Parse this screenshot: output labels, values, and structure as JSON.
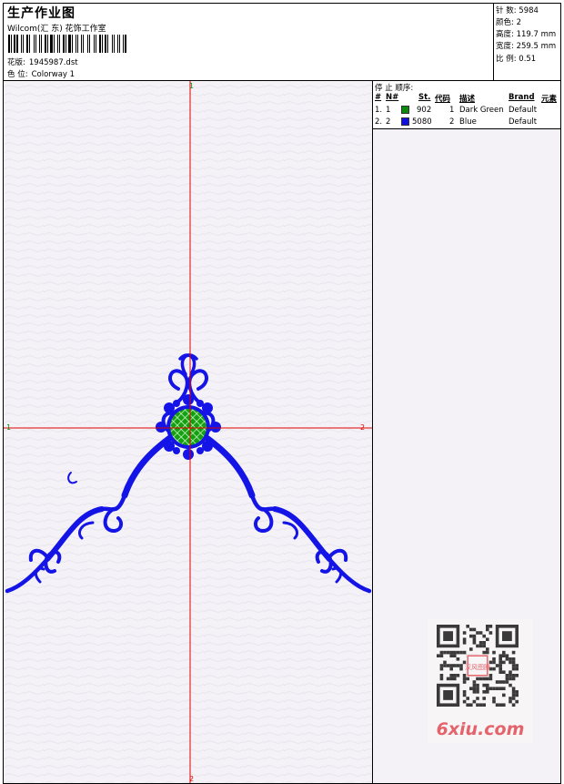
{
  "header": {
    "title": "生产作业图",
    "company": "Wilcom(汇 东) 花饰工作室",
    "design_label": "花版:",
    "design_value": "1945987.dst",
    "colorway_label": "色 位:",
    "colorway_value": "Colorway 1",
    "stats": [
      {
        "label": "针 数:",
        "value": "5984"
      },
      {
        "label": "颜色:",
        "value": "2"
      },
      {
        "label": "高度:",
        "value": "119.7 mm"
      },
      {
        "label": "宽度:",
        "value": "259.5 mm"
      },
      {
        "label": "比 例:",
        "value": "0.51"
      }
    ]
  },
  "stop_sequence": {
    "title": "停 止 顺序:",
    "columns": [
      "#",
      "N#",
      "St.",
      "代码",
      "描述",
      "Brand",
      "元素"
    ],
    "rows": [
      {
        "index": "1.",
        "n": "1",
        "color": "#0b8a0b",
        "stitches": "902",
        "code": "1",
        "description": "Dark Green",
        "brand": "Default"
      },
      {
        "index": "2.",
        "n": "2",
        "color": "#1010e0",
        "stitches": "5080",
        "code": "2",
        "description": "Blue",
        "brand": "Default"
      }
    ]
  },
  "axes": {
    "top": "1",
    "bottom": "2",
    "left": "1",
    "right": "2"
  },
  "colors": {
    "thread_blue": "#1414e6",
    "thread_green": "#0f9a10",
    "axis_red": "#e00000",
    "canvas": "#f4f2f7"
  },
  "watermark": {
    "logo_text": "6xiu.com",
    "stamp_text": "汉风图腾"
  }
}
